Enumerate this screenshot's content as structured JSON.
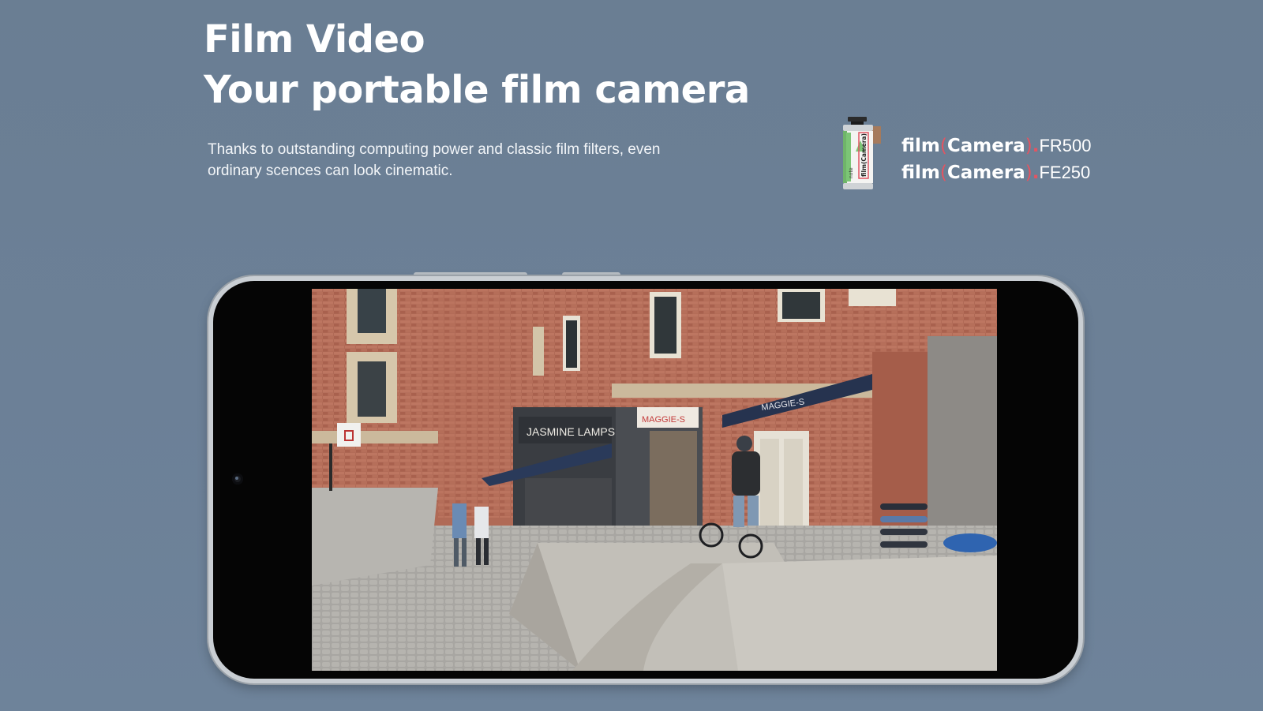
{
  "hero": {
    "title_line1": "Film Video",
    "title_line2": "Your portable film camera",
    "description": "Thanks to outstanding computing power and classic film filters, even ordinary scences can look cinematic."
  },
  "film_models": [
    {
      "prefix": "film",
      "open": "(",
      "name": "Camera",
      "close": ")",
      "dot": ".",
      "model": "FR500"
    },
    {
      "prefix": "film",
      "open": "(",
      "name": "Camera",
      "close": ")",
      "dot": ".",
      "model": "FE250"
    }
  ],
  "canister": {
    "brand": "note",
    "label": "film(Camera)"
  },
  "video_scene": {
    "sign_jasmine": "JASMINE LAMPS",
    "sign_maggie_1": "MAGGIE-S",
    "sign_maggie_2": "MAGGIE-S"
  },
  "colors": {
    "background": "#6b7f95",
    "accent": "#e25562",
    "text": "#ffffff"
  },
  "icons": {
    "canister": "film-canister-icon",
    "front_camera": "front-camera-icon"
  }
}
